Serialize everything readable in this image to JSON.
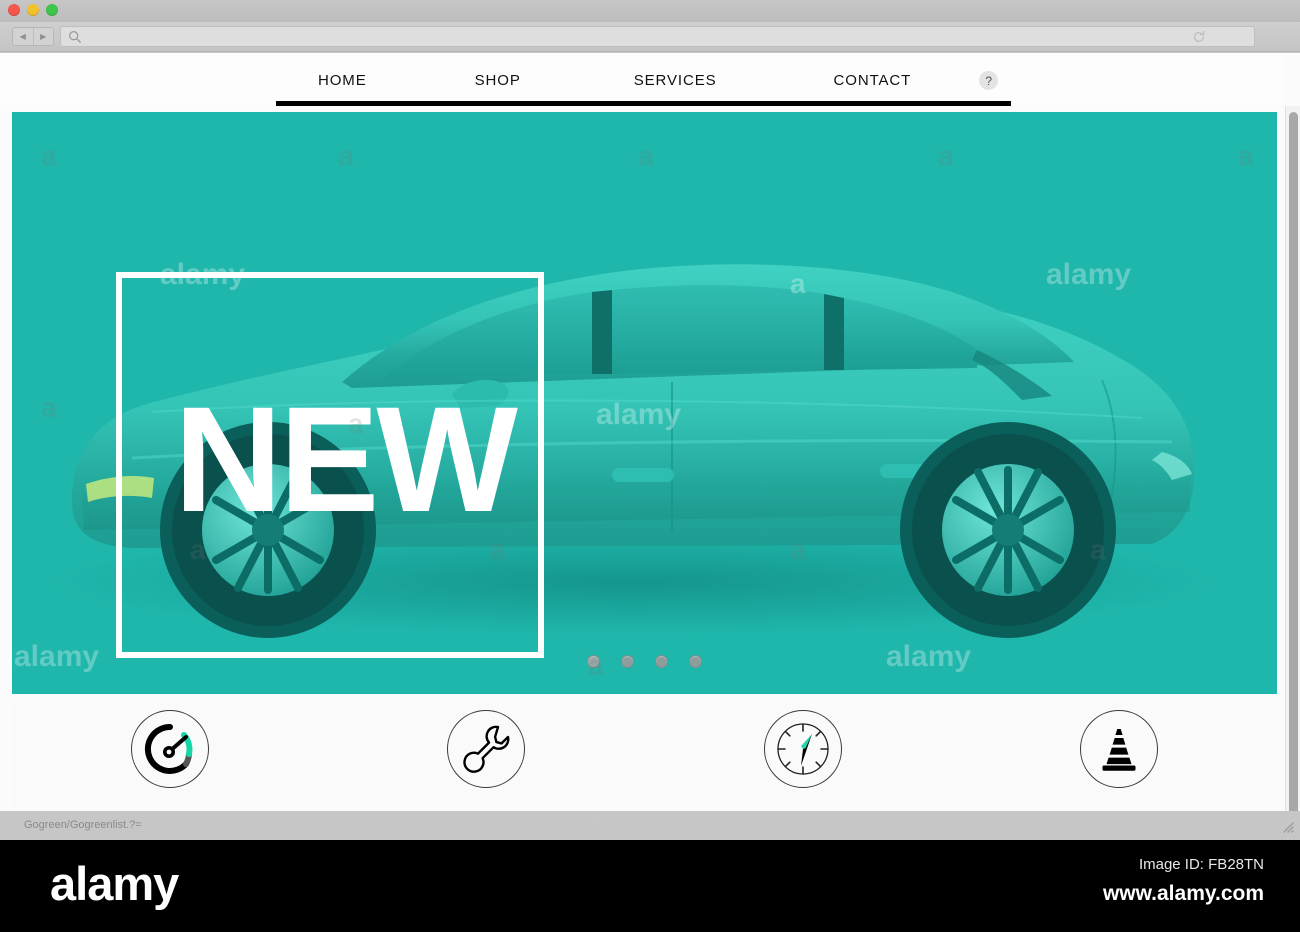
{
  "browser": {
    "traffic_lights": [
      {
        "name": "close",
        "color": "#f6564c"
      },
      {
        "name": "minimize",
        "color": "#f2c12e"
      },
      {
        "name": "maximize",
        "color": "#3fc54c"
      }
    ],
    "back_glyph": "◀",
    "forward_glyph": "▶",
    "address_value": "",
    "address_placeholder": "",
    "search_icon": "search-icon",
    "reload_icon": "reload-icon"
  },
  "site_nav": {
    "items": [
      {
        "label": "HOME"
      },
      {
        "label": "SHOP"
      },
      {
        "label": "SERVICES"
      },
      {
        "label": "CONTACT"
      }
    ],
    "help_label": "?"
  },
  "hero": {
    "background_color": "#1fb6ab",
    "headline": "NEW",
    "subject": "car",
    "carousel": {
      "count": 4,
      "active_index": 0
    }
  },
  "features": {
    "icons": [
      {
        "name": "speedometer-icon",
        "accent": "#12d8a8"
      },
      {
        "name": "wrench-icon",
        "accent": "#000000"
      },
      {
        "name": "compass-icon",
        "accent": "#2ad4ae"
      },
      {
        "name": "traffic-cone-icon",
        "accent": "#000000"
      }
    ]
  },
  "statusbar": {
    "text": "Gogreen/Gogreenlist.?="
  },
  "watermark": {
    "word": "alamy",
    "letter": "a"
  },
  "footer": {
    "logo": "alamy",
    "image_id": "Image ID: FB28TN",
    "url": "www.alamy.com"
  }
}
